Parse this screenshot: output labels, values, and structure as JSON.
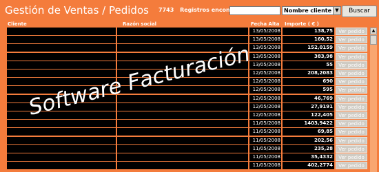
{
  "header": {
    "title": "Gestión de Ventas / Pedidos",
    "count": "7743",
    "count_label": "Registros encontrados",
    "search_value": "",
    "filter_selected": "Nombre cliente",
    "search_button": "Buscar"
  },
  "columns": {
    "cliente": "Cliente",
    "razon": "Razón social",
    "fecha": "Fecha Alta",
    "importe": "Importe ( € )"
  },
  "rows": [
    {
      "fecha": "13/05/2008",
      "importe": "138,75",
      "action": "Ver pedido"
    },
    {
      "fecha": "13/05/2008",
      "importe": "160,52",
      "action": "Ver pedido"
    },
    {
      "fecha": "13/05/2008",
      "importe": "152,0159",
      "action": "Ver pedido"
    },
    {
      "fecha": "13/05/2008",
      "importe": "383,98",
      "action": "Ver pedido"
    },
    {
      "fecha": "13/05/2008",
      "importe": "55",
      "action": "Ver pedido"
    },
    {
      "fecha": "12/05/2008",
      "importe": "208,2083",
      "action": "Ver pedido"
    },
    {
      "fecha": "12/05/2008",
      "importe": "690",
      "action": "Ver pedido"
    },
    {
      "fecha": "12/05/2008",
      "importe": "595",
      "action": "Ver pedido"
    },
    {
      "fecha": "12/05/2008",
      "importe": "46,769",
      "action": "Ver pedido"
    },
    {
      "fecha": "12/05/2008",
      "importe": "27,9191",
      "action": "Ver pedido"
    },
    {
      "fecha": "12/05/2008",
      "importe": "122,405",
      "action": "Ver pedido"
    },
    {
      "fecha": "11/05/2008",
      "importe": "1403,9422",
      "action": "Ver pedido"
    },
    {
      "fecha": "11/05/2008",
      "importe": "69,85",
      "action": "Ver pedido"
    },
    {
      "fecha": "11/05/2008",
      "importe": "202,56",
      "action": "Ver pedido"
    },
    {
      "fecha": "11/05/2008",
      "importe": "235,28",
      "action": "Ver pedido"
    },
    {
      "fecha": "11/05/2008",
      "importe": "35,4332",
      "action": "Ver pedido"
    },
    {
      "fecha": "11/05/2008",
      "importe": "402,2774",
      "action": "Ver pedido"
    }
  ],
  "watermark": "Software Facturación",
  "colors": {
    "background": "#f47c3c",
    "cell": "#000000",
    "button": "#cfcbc3"
  },
  "icons": {
    "select_arrow": "chevron-down-icon",
    "scroll_up": "scroll-up-arrow-icon"
  }
}
